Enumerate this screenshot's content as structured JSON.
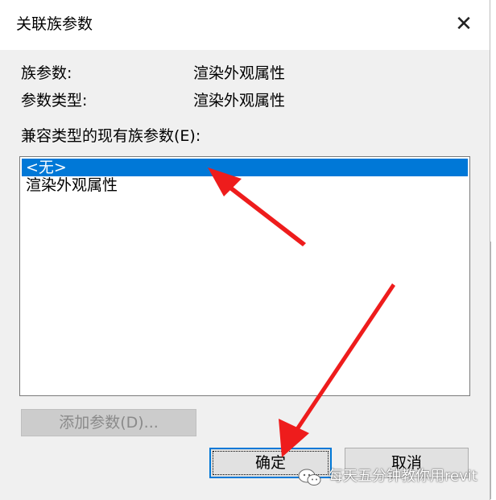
{
  "dialog": {
    "title": "关联族参数",
    "close_glyph": "✕"
  },
  "info": {
    "family_param_label": "族参数:",
    "family_param_value": "渲染外观属性",
    "param_type_label": "参数类型:",
    "param_type_value": "渲染外观属性"
  },
  "list": {
    "label": "兼容类型的现有族参数(E):",
    "items": [
      {
        "label": "<无>",
        "selected": true
      },
      {
        "label": "渲染外观属性",
        "selected": false
      }
    ]
  },
  "buttons": {
    "add_param": "添加参数(D)...",
    "ok": "确定",
    "cancel": "取消"
  },
  "watermark": {
    "text": "每天五分钟教你用revit"
  },
  "colors": {
    "selection": "#0078d7",
    "arrow": "#ee1c1c"
  }
}
